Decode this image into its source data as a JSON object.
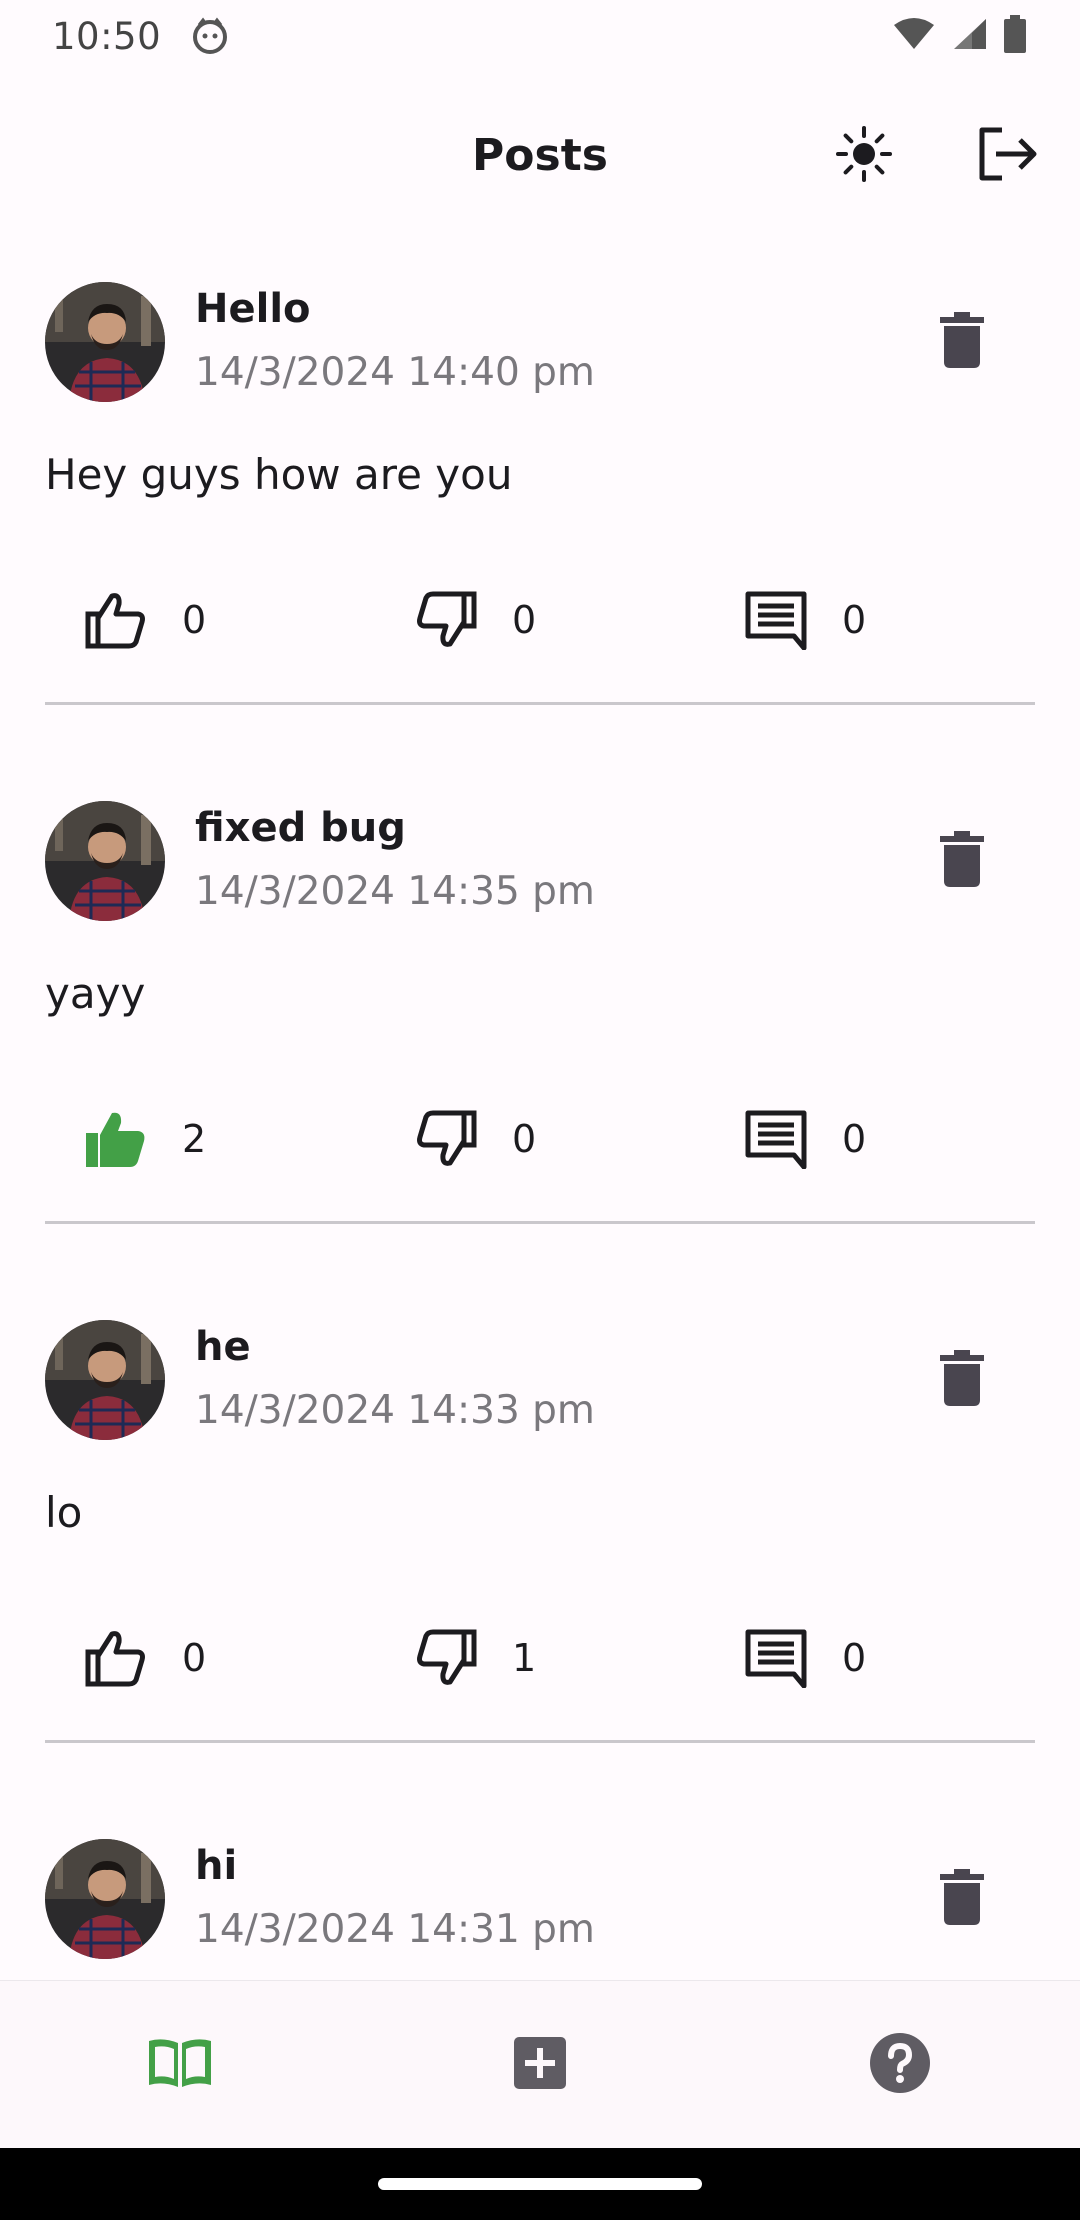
{
  "status_bar": {
    "time": "10:50"
  },
  "app_bar": {
    "title": "Posts"
  },
  "posts": [
    {
      "title": "Hello",
      "date": "14/3/2024 14:40 pm",
      "body": "Hey guys how are you",
      "likes": "0",
      "dislikes": "0",
      "comments": "0",
      "liked": false
    },
    {
      "title": "fixed bug",
      "date": "14/3/2024 14:35 pm",
      "body": "yayy",
      "likes": "2",
      "dislikes": "0",
      "comments": "0",
      "liked": true
    },
    {
      "title": "he",
      "date": "14/3/2024 14:33 pm",
      "body": "lo",
      "likes": "0",
      "dislikes": "1",
      "comments": "0",
      "liked": false
    },
    {
      "title": "hi",
      "date": "14/3/2024 14:31 pm",
      "body": "",
      "likes": "",
      "dislikes": "",
      "comments": "",
      "liked": false
    }
  ],
  "colors": {
    "accent_green": "#43a047",
    "icon_dark": "#49454f",
    "divider": "#cac7cc",
    "background": "#fffbfe"
  },
  "icons": {
    "theme": "sun-icon",
    "logout": "logout-icon",
    "delete": "trash-icon",
    "like": "thumb-up-icon",
    "dislike": "thumb-down-icon",
    "comment": "comment-icon",
    "nav_posts": "book-icon",
    "nav_add": "add-box-icon",
    "nav_help": "help-icon"
  }
}
